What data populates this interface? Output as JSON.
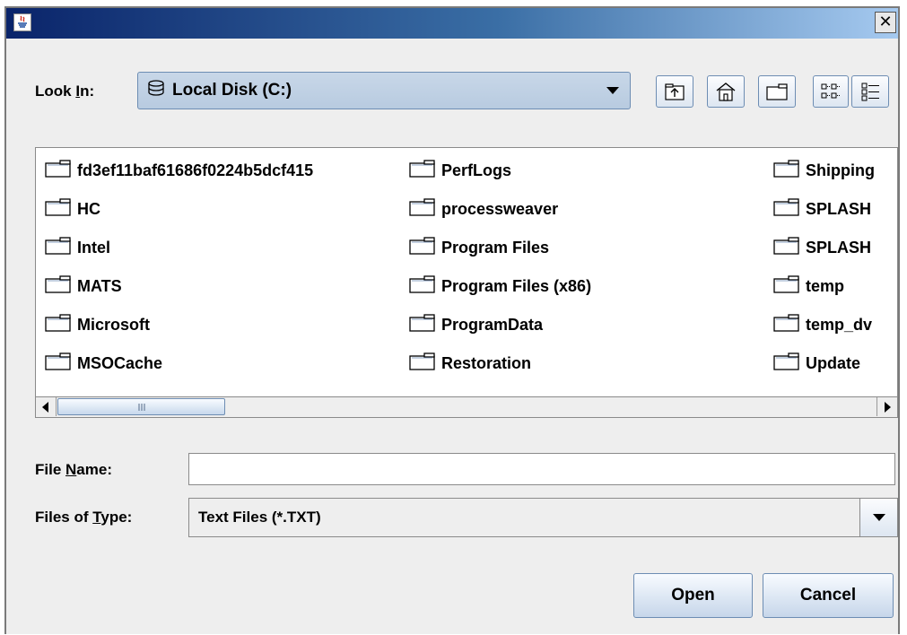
{
  "window": {
    "title": ""
  },
  "lookin": {
    "label_prefix": "Look ",
    "label_mnemonic": "I",
    "label_suffix": "n:",
    "value": "Local Disk (C:)"
  },
  "toolbar": {
    "icons": [
      "up-one-level-icon",
      "home-icon",
      "new-folder-icon",
      "list-view-icon",
      "details-view-icon"
    ]
  },
  "files": {
    "columns": [
      [
        "fd3ef11baf61686f0224b5dcf415",
        "HC",
        "Intel",
        "MATS",
        "Microsoft",
        "MSOCache"
      ],
      [
        "PerfLogs",
        "processweaver",
        "Program Files",
        "Program Files (x86)",
        "ProgramData",
        "Restoration"
      ],
      [
        "Shipping",
        "SPLASH",
        "SPLASH",
        "temp",
        "temp_dv",
        "Update"
      ]
    ]
  },
  "filename": {
    "label_prefix": "File ",
    "label_mnemonic": "N",
    "label_suffix": "ame:",
    "value": ""
  },
  "filetype": {
    "label_prefix": "Files of ",
    "label_mnemonic": "T",
    "label_suffix": "ype:",
    "value": "Text Files (*.TXT)"
  },
  "buttons": {
    "open": "Open",
    "cancel": "Cancel"
  },
  "colors": {
    "titlebar_start": "#0a246a",
    "titlebar_end": "#a6caf0",
    "accent_border": "#6d8db3",
    "dialog_bg": "#eeeeee"
  }
}
